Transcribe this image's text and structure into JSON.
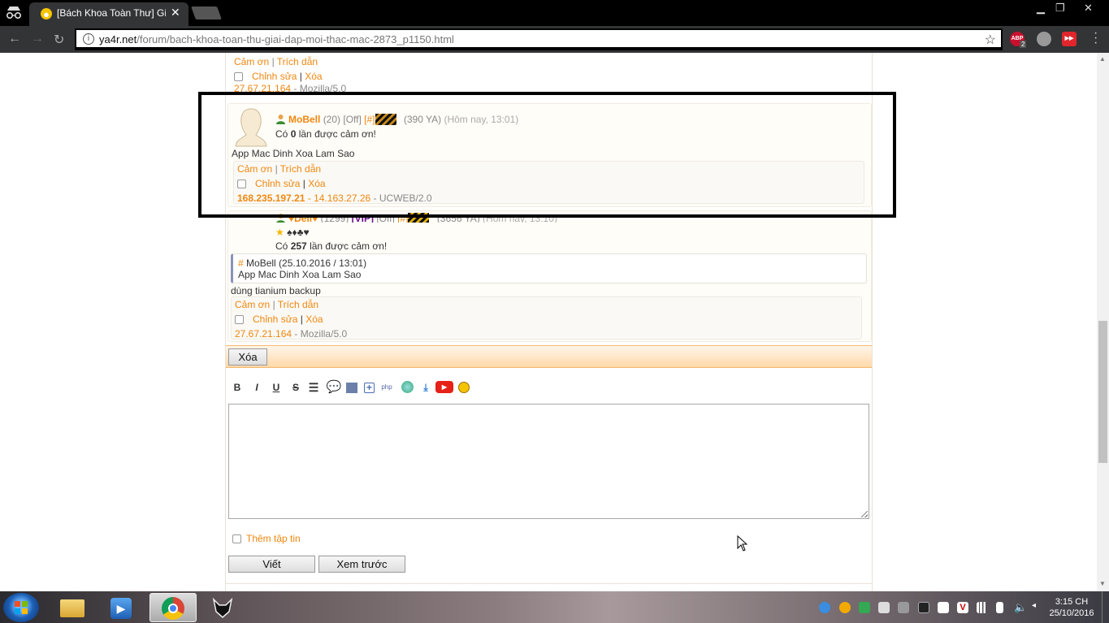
{
  "browser": {
    "tab_title": "[Bách Khoa Toàn Thư] Gi",
    "url_host": "ya4r.net",
    "url_path": "/forum/bach-khoa-toan-thu-giai-dap-moi-thac-mac-2873_p1150.html",
    "ext_abp_label": "ABP",
    "ext_abp_badge": "2"
  },
  "post_prev": {
    "thanks_label": "Cảm ơn",
    "quote_label": "Trích dẫn",
    "edit_label": "Chỉnh sửa",
    "delete_label": "Xóa",
    "ip": "27.67.21.164",
    "agent": "Mozilla/5.0"
  },
  "post_mobell": {
    "username": "MoBell",
    "level": "(20)",
    "status": "[Off]",
    "anchor": "[#]",
    "ya": "(390 YA)",
    "time": "(Hôm nay, 13:01)",
    "thanks_prefix": "Có",
    "thanks_count": "0",
    "thanks_suffix": "lần được cảm ơn!",
    "content": "App Mac Dinh Xoa Lam Sao",
    "thanks_label": "Cảm ơn",
    "quote_label": "Trích dẫn",
    "edit_label": "Chỉnh sửa",
    "delete_label": "Xóa",
    "ip_primary": "168.235.197.21",
    "ip_secondary": "14.163.27.26",
    "agent": "UCWEB/2.0"
  },
  "post_reply": {
    "username": "♥Dell♥",
    "level": "(1299)",
    "vip": "[VIP]",
    "status": "[Off]",
    "anchor": "[#]",
    "ya": "(3656 YA)",
    "time": "(Hôm nay, 13:10)",
    "signature": "♠♦♣♥",
    "thanks_prefix": "Có",
    "thanks_count": "257",
    "thanks_suffix": "lần được cảm ơn!",
    "quote_hash": "#",
    "quote_header": "MoBell (25.10.2016 / 13:01)",
    "quote_text": "App Mac Dinh Xoa Lam Sao",
    "content": "dùng tianium backup",
    "thanks_label": "Cảm ơn",
    "quote_label": "Trích dẫn",
    "edit_label": "Chỉnh sửa",
    "delete_label": "Xóa",
    "ip": "27.67.21.164",
    "agent": "Mozilla/5.0"
  },
  "actions": {
    "delete_button": "Xóa"
  },
  "editor": {
    "toolbar": [
      "B",
      "I",
      "U",
      "S"
    ],
    "attach_label": "Thêm tập tin",
    "submit_button": "Viết",
    "preview_button": "Xem trước"
  },
  "taskbar": {
    "time": "3:15 CH",
    "date": "25/10/2016"
  },
  "colors": {
    "accent": "#f0870f",
    "vip": "#6a0f8e",
    "highlight_border": "#000000"
  }
}
